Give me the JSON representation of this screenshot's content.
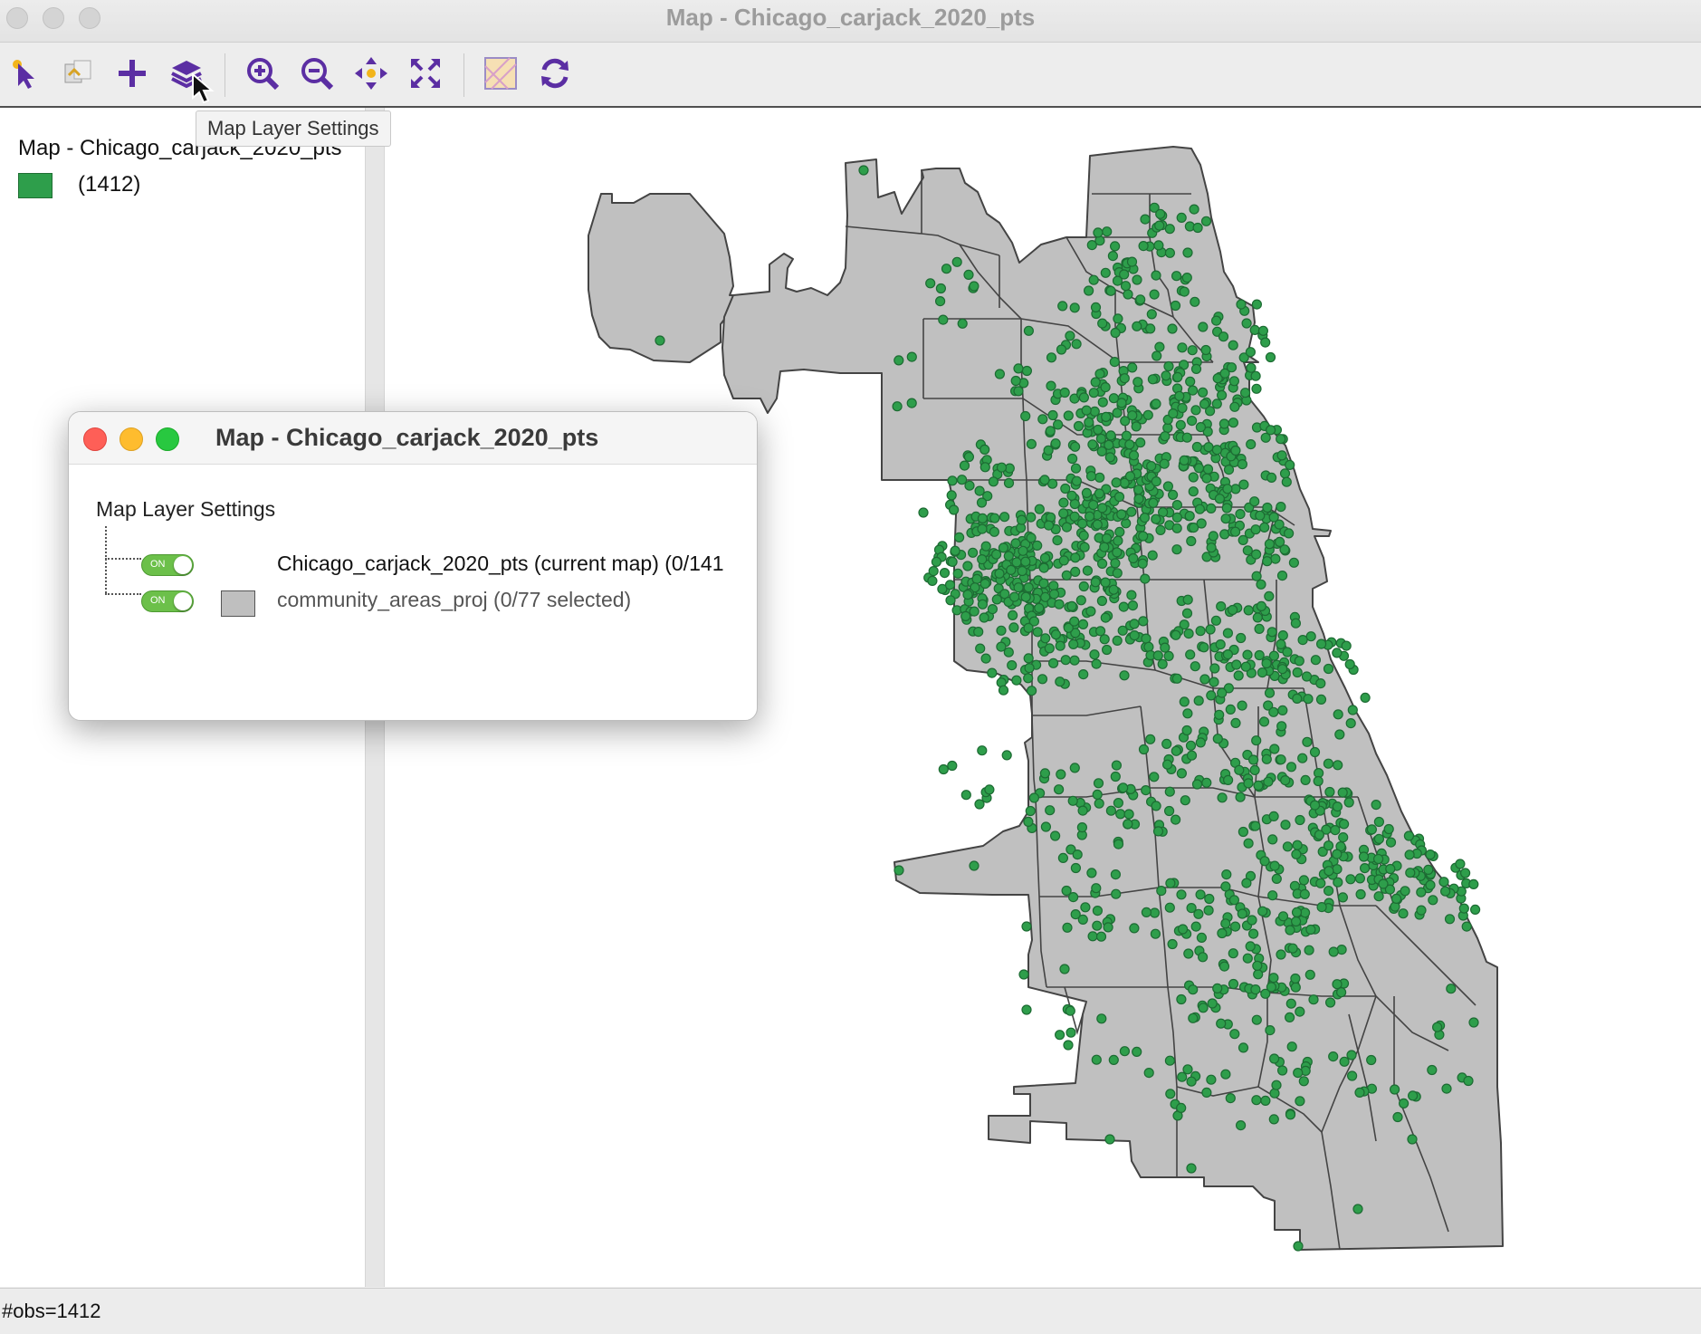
{
  "window": {
    "title": "Map - Chicago_carjack_2020_pts"
  },
  "toolbar": {
    "buttons": [
      {
        "icon": "select-pointer-icon"
      },
      {
        "icon": "selection-copy-icon"
      },
      {
        "icon": "add-layer-icon"
      },
      {
        "icon": "map-layers-icon"
      },
      {
        "icon": "zoom-in-icon"
      },
      {
        "icon": "zoom-out-icon"
      },
      {
        "icon": "pan-icon"
      },
      {
        "icon": "full-extent-icon"
      },
      {
        "icon": "basemap-icon"
      },
      {
        "icon": "refresh-icon"
      }
    ],
    "tooltip": "Map Layer Settings"
  },
  "legend": {
    "title": "Map - Chicago_carjack_2020_pts",
    "count": "(1412)",
    "swatch_color": "#2e9e4b"
  },
  "map": {
    "point_color": "#2e9e4b",
    "polygon_fill": "#c0c0c0",
    "polygon_stroke": "#444444"
  },
  "dialog": {
    "title": "Map - Chicago_carjack_2020_pts",
    "heading": "Map Layer Settings",
    "layers": [
      {
        "toggle": "ON",
        "label": "Chicago_carjack_2020_pts (current map) (0/141"
      },
      {
        "toggle": "ON",
        "label": "community_areas_proj (0/77 selected)"
      }
    ]
  },
  "status": {
    "text": "#obs=1412"
  }
}
